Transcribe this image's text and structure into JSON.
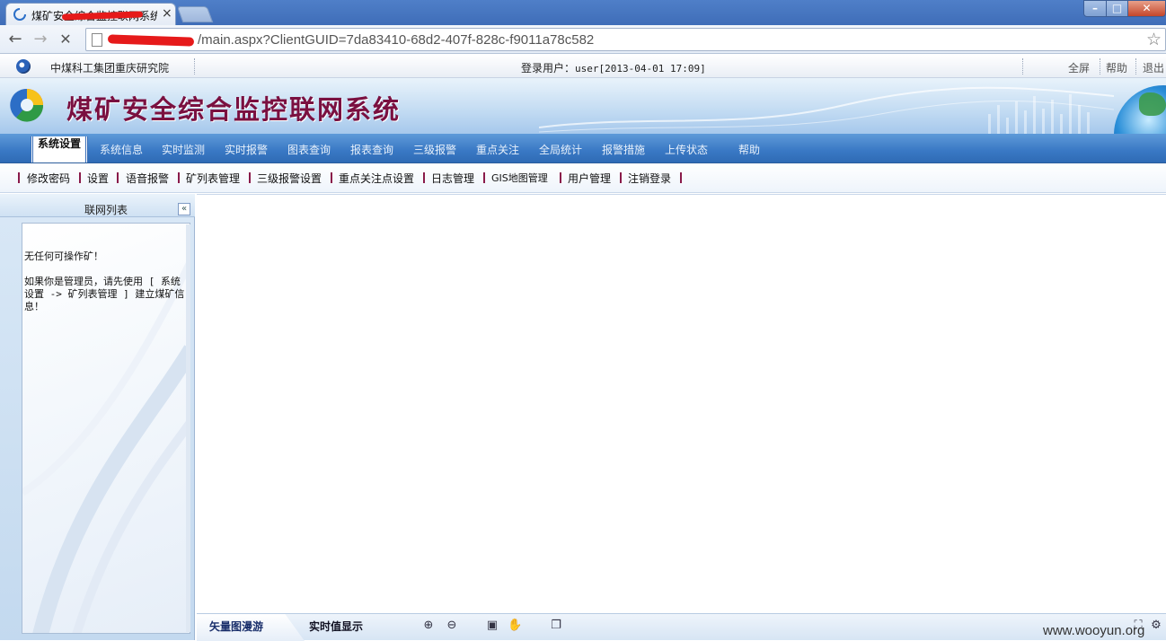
{
  "browser": {
    "tab_title": "煤矿安全综合监控联网系统",
    "tab_close": "×",
    "url": "/main.aspx?ClientGUID=7da83410-68d2-407f-828c-f9011a78c582",
    "back": "←",
    "forward": "→",
    "stop": "✕",
    "star": "☆",
    "min": "–",
    "max": "□",
    "close": "✕"
  },
  "topbar": {
    "org_name": "中煤科工集团重庆研究院",
    "login_label": "登录用户：",
    "login_value": "user[2013-04-01 17:09]",
    "links": {
      "fullscreen": "全屏",
      "help": "帮助",
      "logout": "退出"
    }
  },
  "banner": {
    "title": "煤矿安全综合监控联网系统"
  },
  "mainnav": {
    "active": "系统设置",
    "items": [
      "系统信息",
      "实时监测",
      "实时报警",
      "图表查询",
      "报表查询",
      "三级报警",
      "重点关注",
      "全局统计",
      "报警措施",
      "上传状态",
      "帮助"
    ]
  },
  "subnav": {
    "items": [
      "修改密码",
      "设置",
      "语音报警",
      "矿列表管理",
      "三级报警设置",
      "重点关注点设置",
      "日志管理",
      "GIS地图管理",
      "用户管理",
      "注销登录"
    ]
  },
  "sidebar": {
    "title": "联网列表",
    "collapse": "«",
    "message1": "无任何可操作矿！",
    "message2": "如果你是管理员，请先使用 [ 系统设置 -> 矿列表管理 ] 建立煤矿信息！"
  },
  "bottombar": {
    "tab_vector": "矢量图漫游",
    "tab_realtime": "实时值显示"
  },
  "watermark": "www.wooyun.org",
  "colors": {
    "banner_title": "#7a1040",
    "nav_bg": "#3978c4",
    "sub_bar": "#8a1a4a"
  }
}
